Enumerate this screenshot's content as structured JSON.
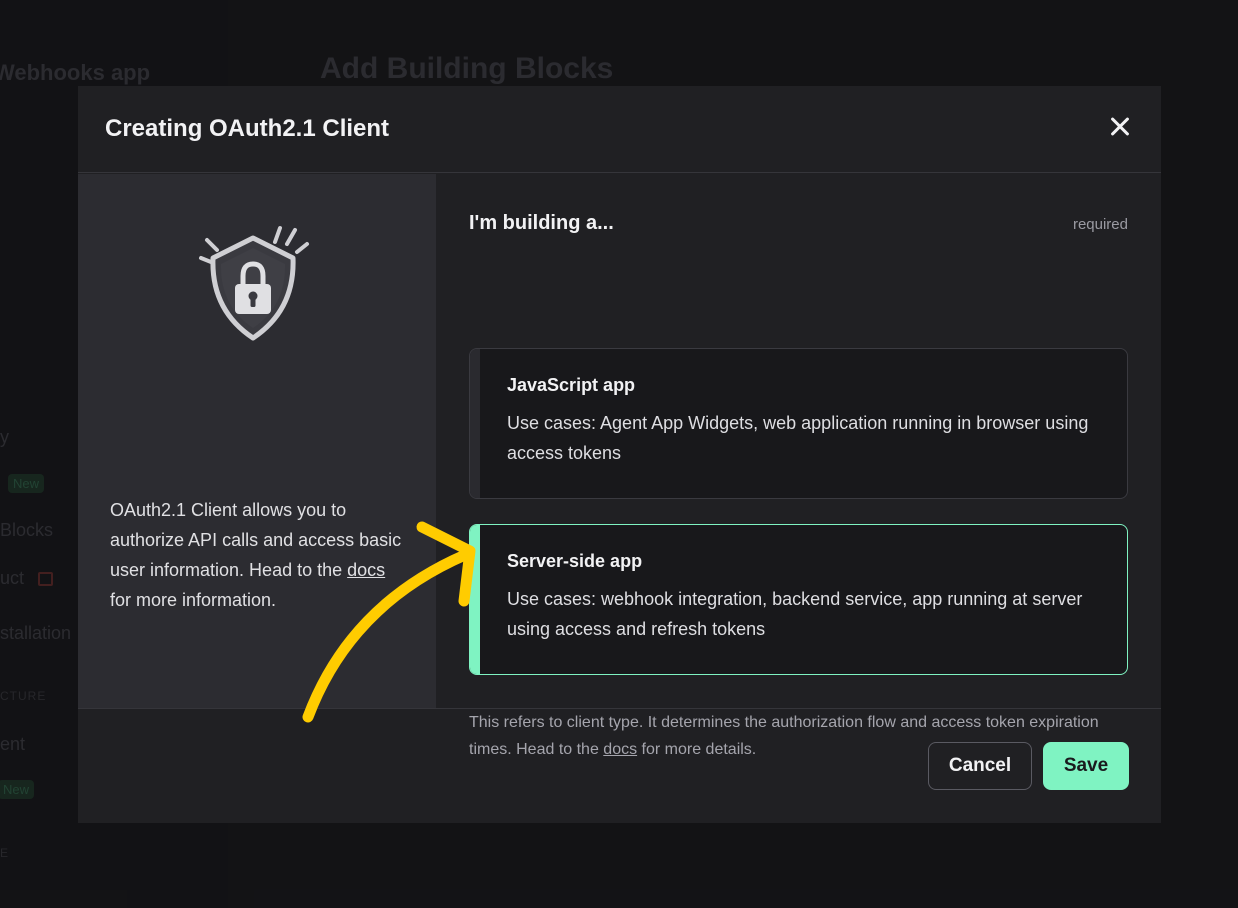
{
  "background": {
    "app_title": "Webhooks app",
    "heading": "Add Building Blocks",
    "sidebar_items": [
      "y",
      "Blocks",
      "uct",
      "stallation",
      "ent"
    ],
    "section_label": "CTURE",
    "section_label_2": "E",
    "badge_new": "New"
  },
  "modal": {
    "title": "Creating OAuth2.1 Client",
    "left": {
      "desc_before": "OAuth2.1 Client allows you to authorize API calls and access basic user information. Head to the ",
      "docs_link": "docs",
      "desc_after": " for more information."
    },
    "right": {
      "label": "I'm building a...",
      "required": "required",
      "options": [
        {
          "title": "JavaScript app",
          "desc": "Use cases: Agent App Widgets, web application running in browser using access tokens"
        },
        {
          "title": "Server-side app",
          "desc": "Use cases: webhook integration, backend service, app running at server using access and refresh tokens"
        }
      ],
      "selected": "Server-side app",
      "hint_before": "This refers to client type. It determines the authorization flow and access token expiration times. Head to the ",
      "hint_link": "docs",
      "hint_after": " for more details."
    },
    "footer": {
      "cancel": "Cancel",
      "save": "Save"
    }
  },
  "colors": {
    "accent": "#7ff3c2",
    "annotation_arrow": "#ffcc00"
  }
}
